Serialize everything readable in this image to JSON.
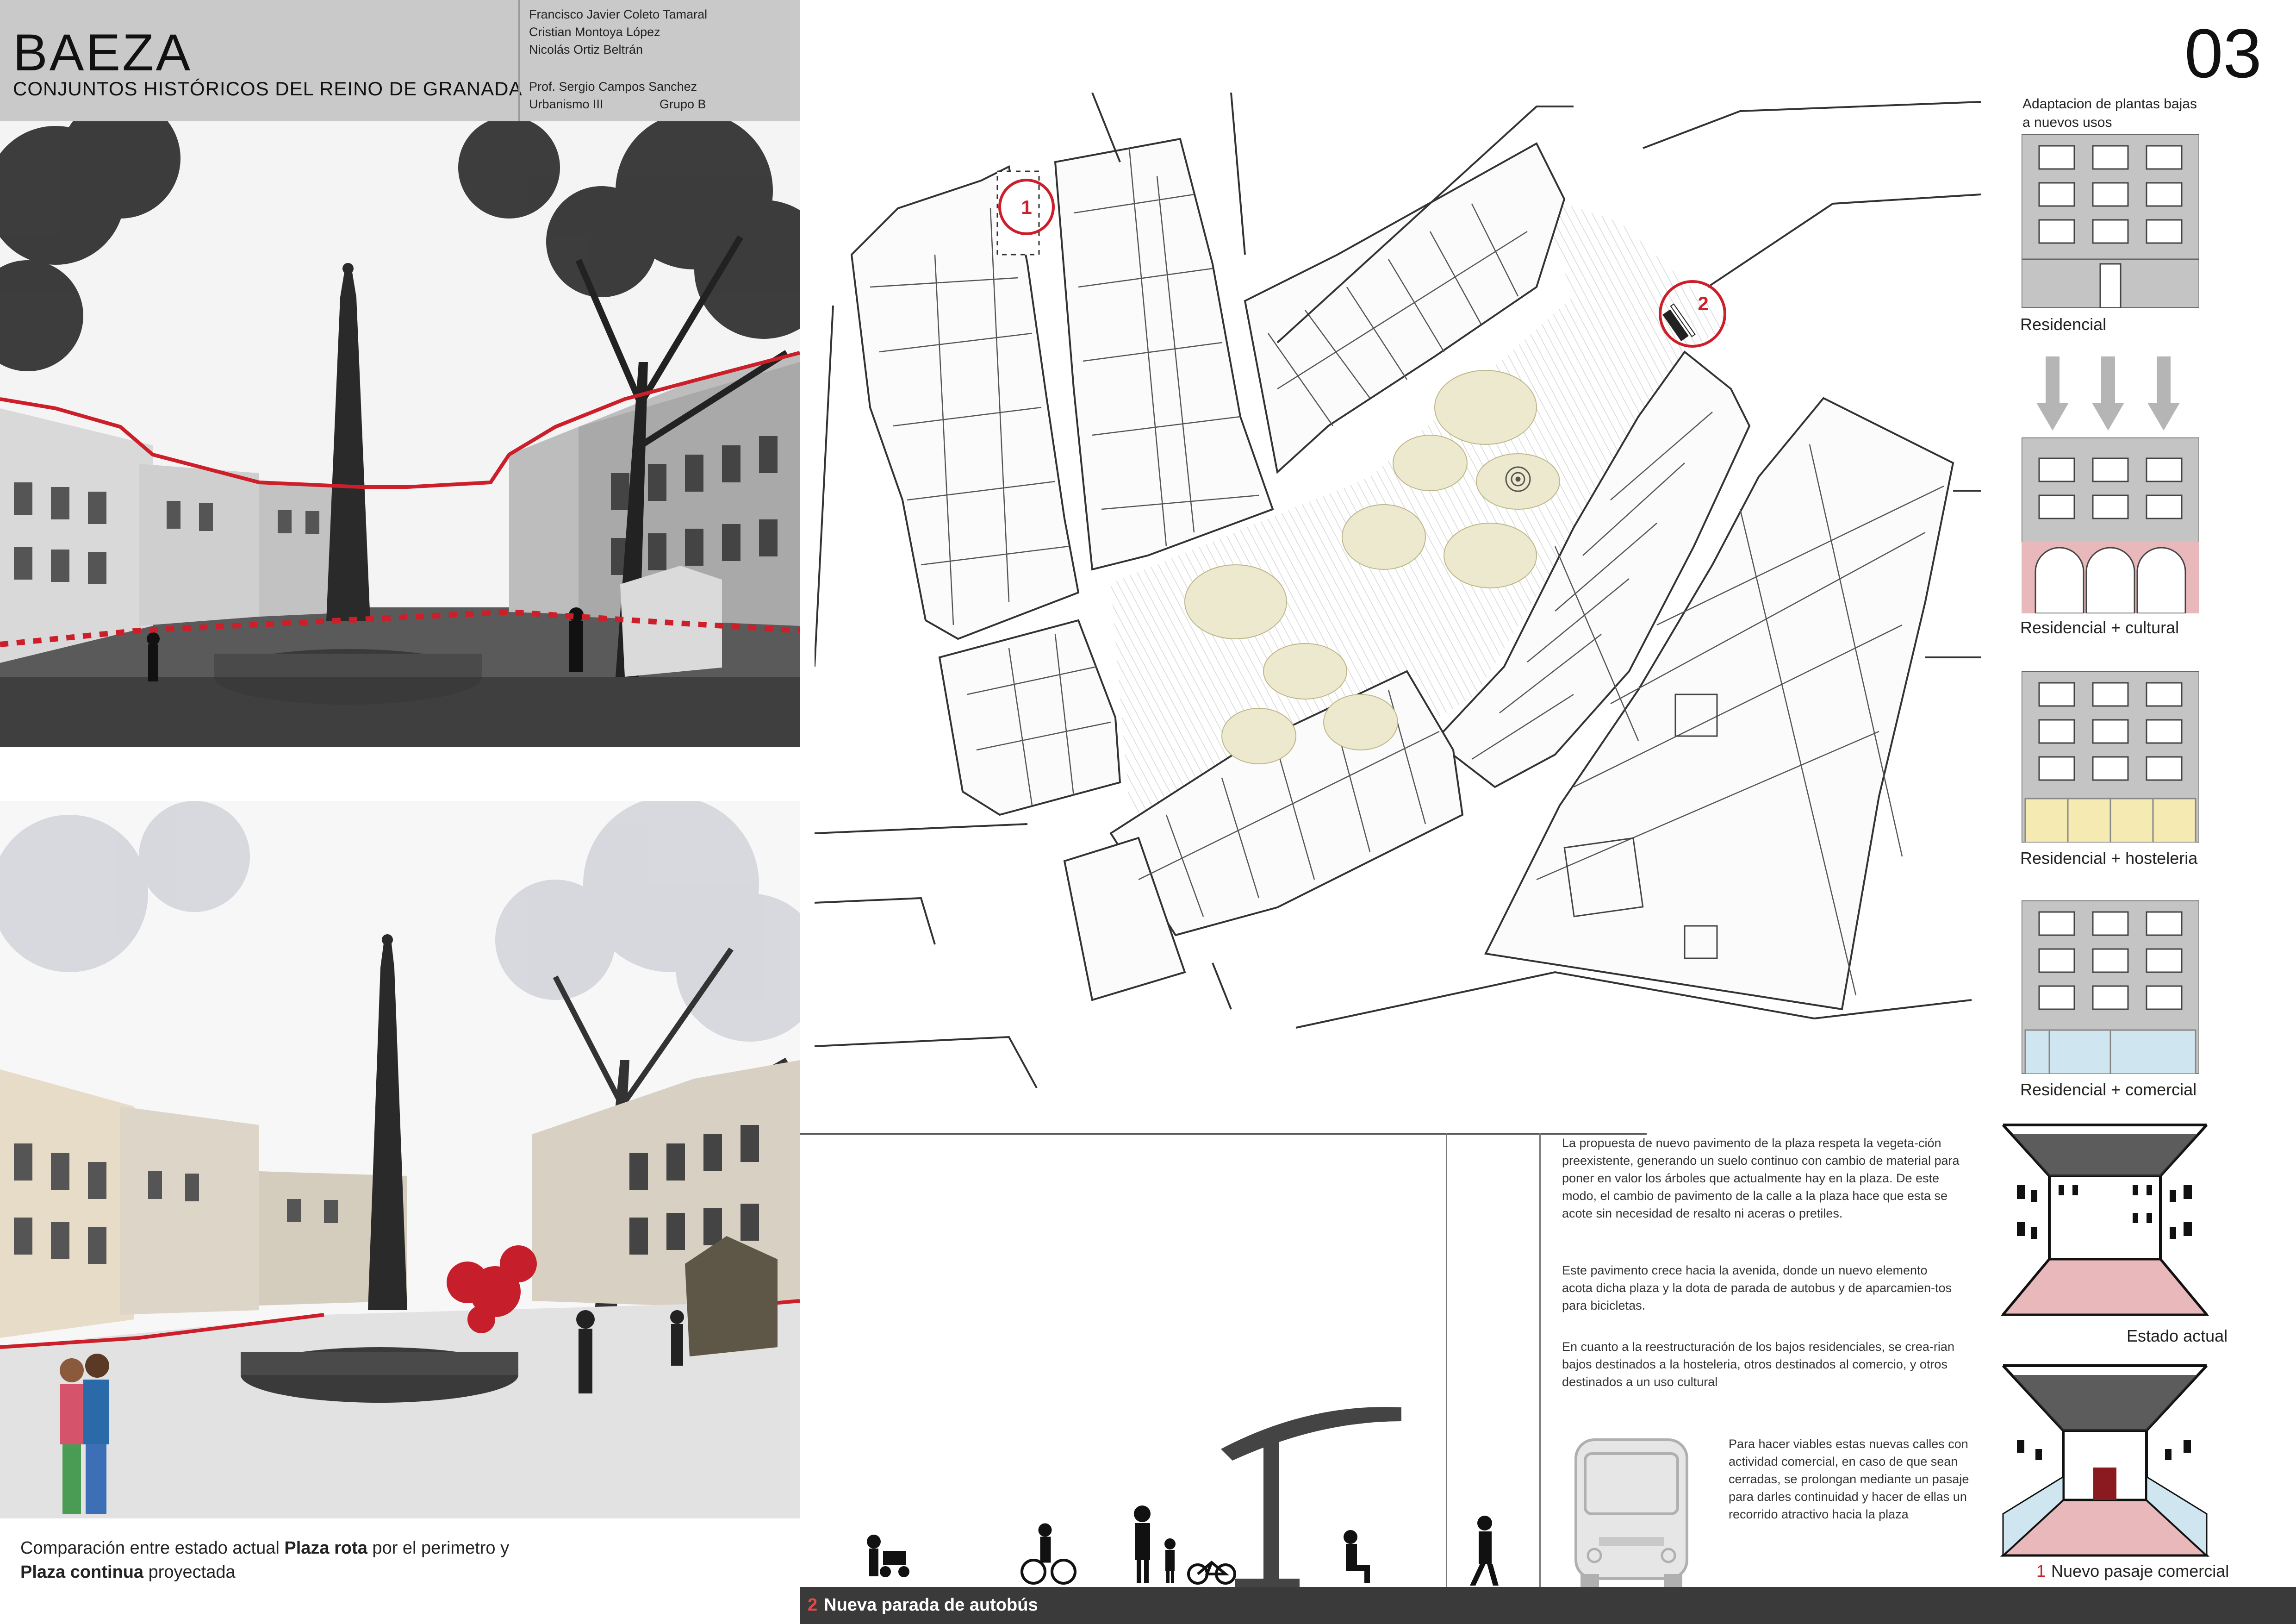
{
  "header": {
    "title": "BAEZA",
    "subtitle": "CONJUNTOS HISTÓRICOS DEL REINO DE GRANADA",
    "authors": [
      "Francisco Javier Coleto Tamaral",
      "Cristian Montoya López",
      "Nicolás Ortiz Beltrán"
    ],
    "professor": "Prof. Sergio Campos Sanchez",
    "course": "Urbanismo III",
    "group": "Grupo B"
  },
  "sheet_number": "03",
  "caption": {
    "line1_pre": "Comparación entre estado actual ",
    "line1_bold": "Plaza rota",
    "line1_post": " por el perimetro y",
    "line2_bold": "Plaza continua",
    "line2_post": " proyectada"
  },
  "plan": {
    "marker_1": "1",
    "marker_2": "2"
  },
  "adaptation": {
    "title_line1": "Adaptacion de plantas bajas",
    "title_line2": "a nuevos usos",
    "states": [
      {
        "label": "Residencial",
        "ground_color": "#c4c4c4"
      },
      {
        "label": "Residencial + cultural",
        "ground_color": "#e9b8bb"
      },
      {
        "label": "Residencial + hosteleria",
        "ground_color": "#f6eab3"
      },
      {
        "label": "Residencial + comercial",
        "ground_color": "#cfe6f0"
      }
    ]
  },
  "sketches": {
    "current_label": "Estado actual",
    "new_number": "1",
    "new_label": "Nuevo pasaje comercial"
  },
  "text": {
    "p1": "La propuesta de nuevo pavimento de la plaza respeta la vegeta-ción preexistente, generando un suelo continuo con cambio de material para poner en valor los  árboles que actualmente hay en la plaza. De este modo, el cambio de pavimento de la calle a la plaza hace que esta se acote sin necesidad de resalto ni aceras o pretiles.",
    "p2": "Este pavimento crece hacia la avenida, donde un nuevo elemento acota dicha plaza y la dota de parada de autobus y de aparcamien-tos para bicicletas.",
    "p3": "En cuanto a la reestructuración de los bajos residenciales, se crea-rian bajos destinados a la hosteleria, otros destinados al comercio, y otros destinados a un uso cultural",
    "p4": "Para hacer viables estas nuevas calles con actividad comercial, en caso de que sean cerradas, se prolongan mediante un pasaje para darles continuidad y hacer de ellas un recorrido atractivo hacia la plaza"
  },
  "bus_stop": {
    "number": "2",
    "label": "Nueva parada de autobús"
  },
  "colors": {
    "accent_red": "#cc1f2a",
    "header_gray": "#c9c9c9",
    "facade_gray": "#c4c4c4",
    "tree_patch": "#ece9cf"
  }
}
